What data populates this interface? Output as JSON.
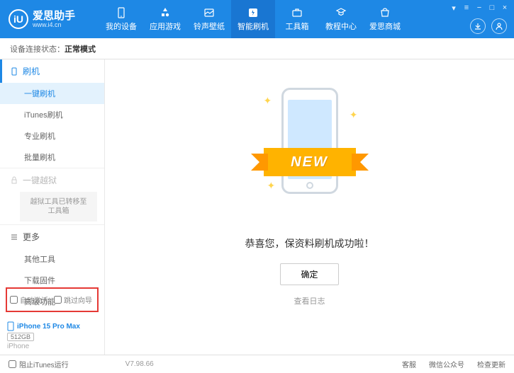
{
  "header": {
    "app_name": "爱思助手",
    "app_url": "www.i4.cn",
    "logo_letter": "iU"
  },
  "nav": [
    {
      "label": "我的设备",
      "icon": "device-icon"
    },
    {
      "label": "应用游戏",
      "icon": "app-icon"
    },
    {
      "label": "铃声壁纸",
      "icon": "wallpaper-icon"
    },
    {
      "label": "智能刷机",
      "icon": "flash-icon",
      "active": true
    },
    {
      "label": "工具箱",
      "icon": "toolbox-icon"
    },
    {
      "label": "教程中心",
      "icon": "tutorial-icon"
    },
    {
      "label": "爱思商城",
      "icon": "shop-icon"
    }
  ],
  "status": {
    "label": "设备连接状态：",
    "value": "正常模式"
  },
  "sidebar": {
    "section_flash": "刷机",
    "items_flash": [
      "一键刷机",
      "iTunes刷机",
      "专业刷机",
      "批量刷机"
    ],
    "section_jailbreak": "一键越狱",
    "jailbreak_note": "越狱工具已转移至工具箱",
    "section_more": "更多",
    "items_more": [
      "其他工具",
      "下载固件",
      "高级功能"
    ],
    "checkbox1": "自动激活",
    "checkbox2": "跳过向导",
    "device_name": "iPhone 15 Pro Max",
    "device_storage": "512GB",
    "device_type": "iPhone"
  },
  "main": {
    "ribbon": "NEW",
    "success_text": "恭喜您，保资料刷机成功啦！",
    "ok_button": "确定",
    "log_link": "查看日志"
  },
  "footer": {
    "block_itunes": "阻止iTunes运行",
    "version": "V7.98.66",
    "items": [
      "客服",
      "微信公众号",
      "检查更新"
    ]
  }
}
